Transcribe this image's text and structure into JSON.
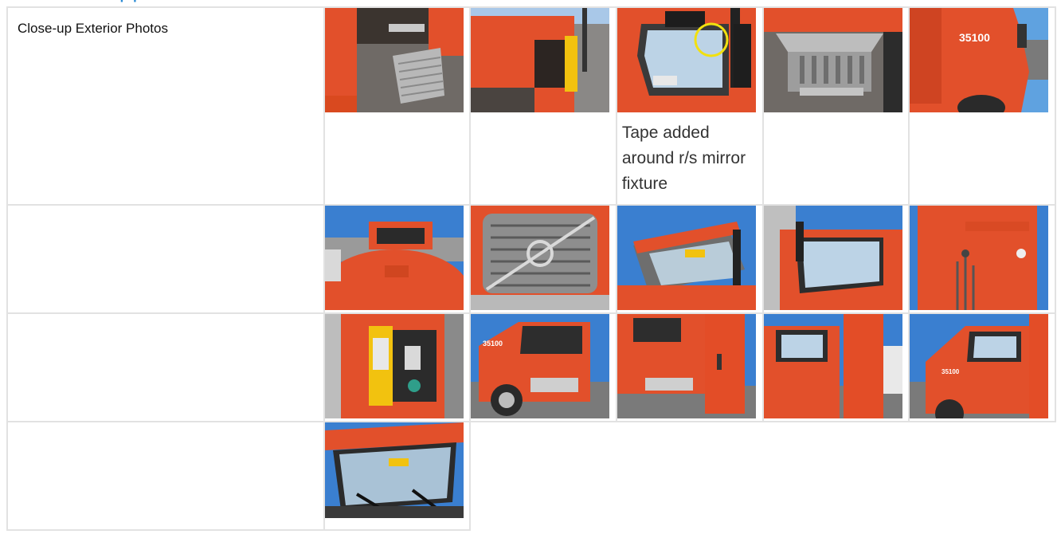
{
  "header": {
    "fragment": "pp"
  },
  "rows": [
    {
      "label": "Close-up Exterior Photos",
      "photos": [
        {
          "name": "step-mudflap-photo",
          "caption": ""
        },
        {
          "name": "side-compartment-photo",
          "caption": ""
        },
        {
          "name": "mirror-fixture-photo",
          "caption": "Tape added around r/s mirror fixture"
        },
        {
          "name": "step-grate-photo",
          "caption": ""
        },
        {
          "name": "cab-side-35100-photo",
          "caption": ""
        }
      ]
    },
    {
      "label": "",
      "photos": [
        {
          "name": "hood-front-photo",
          "caption": ""
        },
        {
          "name": "grille-volvo-photo",
          "caption": ""
        },
        {
          "name": "windshield-visor-photo",
          "caption": ""
        },
        {
          "name": "door-window-photo",
          "caption": ""
        },
        {
          "name": "rear-cab-wall-photo",
          "caption": ""
        }
      ]
    },
    {
      "label": "",
      "photos": [
        {
          "name": "open-panel-photo",
          "caption": ""
        },
        {
          "name": "left-side-cab-photo",
          "caption": ""
        },
        {
          "name": "side-fairing-photo",
          "caption": ""
        },
        {
          "name": "right-side-cab-photo",
          "caption": ""
        },
        {
          "name": "front-quarter-photo",
          "caption": ""
        }
      ]
    },
    {
      "label": "",
      "photos": [
        {
          "name": "windshield-interior-photo",
          "caption": ""
        }
      ]
    }
  ],
  "colors": {
    "truck_orange": "#e2502b",
    "sky_blue": "#3a7fd0",
    "border": "#e2e2e2",
    "label_bg": "#f5f5f5"
  }
}
